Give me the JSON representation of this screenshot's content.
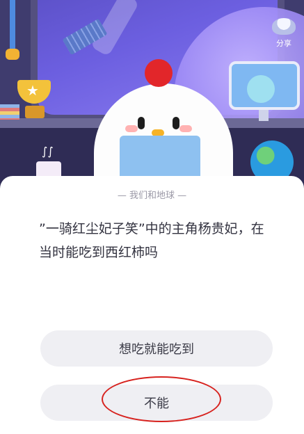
{
  "header": {
    "share_label": "分享",
    "share_icon": "ufo-icon"
  },
  "scene": {
    "illustration": "chick-reading-book-in-spaceship-room"
  },
  "quiz": {
    "topic": "— 我们和地球 —",
    "question": "”一骑红尘妃子笑”中的主角杨贵妃，在当时能吃到西红柿吗",
    "options": [
      {
        "label": "想吃就能吃到"
      },
      {
        "label": "不能",
        "annotated": true
      }
    ]
  },
  "colors": {
    "annotation_circle": "#d7221e",
    "option_bg": "#efeff3",
    "scene_bg": "#3f3c6e"
  }
}
